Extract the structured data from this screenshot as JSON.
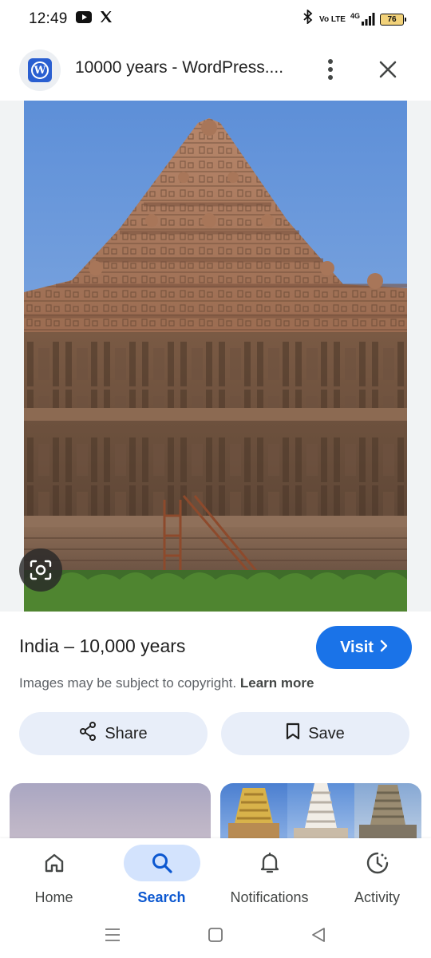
{
  "status_bar": {
    "time": "12:49",
    "left_icons": [
      "youtube-icon",
      "x-icon"
    ],
    "right_icons": [
      "bluetooth-icon",
      "volte-icon",
      "4g-signal-icon",
      "battery-icon"
    ],
    "volte_text": "Vo LTE",
    "network_text": "4G",
    "battery_level": "76"
  },
  "header": {
    "site_icon": "wordpress-icon",
    "title": "10000 years - WordPress....",
    "more_icon": "more-vert-icon",
    "close_icon": "close-icon"
  },
  "image": {
    "subject": "temple-gopuram",
    "lens_icon": "lens-icon"
  },
  "result": {
    "title": "India – 10,000 years",
    "visit_label": "Visit",
    "copyright_text": "Images may be subject to copyright.",
    "learn_more": "Learn more"
  },
  "actions": {
    "share_label": "Share",
    "save_label": "Save"
  },
  "bottom_nav": {
    "items": [
      {
        "label": "Home",
        "icon": "home-icon",
        "active": false
      },
      {
        "label": "Search",
        "icon": "search-icon",
        "active": true
      },
      {
        "label": "Notifications",
        "icon": "bell-icon",
        "active": false
      },
      {
        "label": "Activity",
        "icon": "activity-icon",
        "active": false
      }
    ]
  },
  "system_nav": [
    "menu-icon",
    "home-square-icon",
    "back-icon"
  ],
  "colors": {
    "accent": "#1a73e8",
    "active_nav": "#0b57d0",
    "action_button_bg": "#e8eef9",
    "image_bg": "#f1f3f4"
  }
}
